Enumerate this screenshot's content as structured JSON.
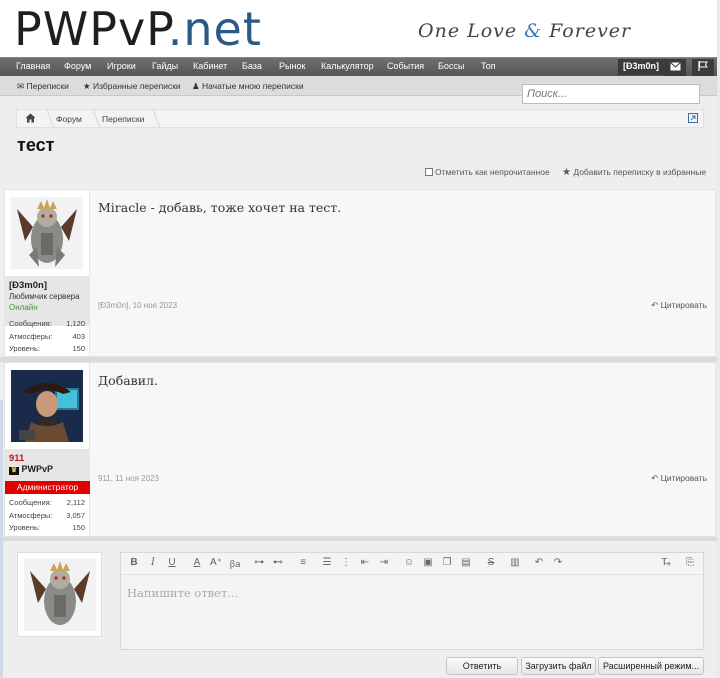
{
  "header": {
    "logo_part1": "PWPvP",
    "logo_part2": ".net",
    "slogan_one": "One Love",
    "slogan_amp": "&",
    "slogan_two": "Forever"
  },
  "nav": {
    "items": [
      "Главная",
      "Форум",
      "Игроки",
      "Гайды",
      "Кабинет",
      "База",
      "Рынок",
      "Калькулятор",
      "События",
      "Боссы",
      "Топ"
    ],
    "user": "[Ð3m0n]",
    "mail_icon": "envelope-icon",
    "flag_icon": "flag-icon"
  },
  "subnav": {
    "items": [
      "Переписки",
      "Избранные переписки",
      "Начатые мною переписки"
    ]
  },
  "search": {
    "placeholder": "Поиск..."
  },
  "breadcrumb": {
    "items": [
      "Форум",
      "Переписки"
    ]
  },
  "page": {
    "title": "тест"
  },
  "actions": {
    "mark_unread": "Отметить как непрочитанное",
    "add_favorite": "Добавить переписку в избранные"
  },
  "posts": [
    {
      "username": "[Ð3m0n]",
      "user_title": "Любимчик сервера",
      "status": "Онлайн",
      "stats": [
        {
          "label": "Сообщения:",
          "value": "1,120"
        },
        {
          "label": "Атмосферы:",
          "value": "403"
        },
        {
          "label": "Уровень:",
          "value": "150"
        }
      ],
      "text": "Miracle - добавь, тоже хочет на тест.",
      "meta": "[Ð3m0n], 10 ноя 2023",
      "quote": "Цитировать"
    },
    {
      "username": "911",
      "user_title": "PWPvP",
      "role": "Администратор",
      "stats": [
        {
          "label": "Сообщения:",
          "value": "2,112"
        },
        {
          "label": "Атмосферы:",
          "value": "3,057"
        },
        {
          "label": "Уровень:",
          "value": "150"
        }
      ],
      "text": "Добавил.",
      "meta": "911, 11 ноя 2023",
      "quote": "Цитировать"
    }
  ],
  "reply": {
    "placeholder": "Напишите ответ...",
    "buttons": {
      "reply": "Ответить",
      "upload": "Загрузить файл",
      "advanced": "Расширенный режим..."
    }
  },
  "colors": {
    "brand_blue": "#2a5a86",
    "nav_bg": "#5f5f5f",
    "online_green": "#3a9a3a",
    "admin_red": "#e00000",
    "admin_name_red": "#c0141a"
  }
}
